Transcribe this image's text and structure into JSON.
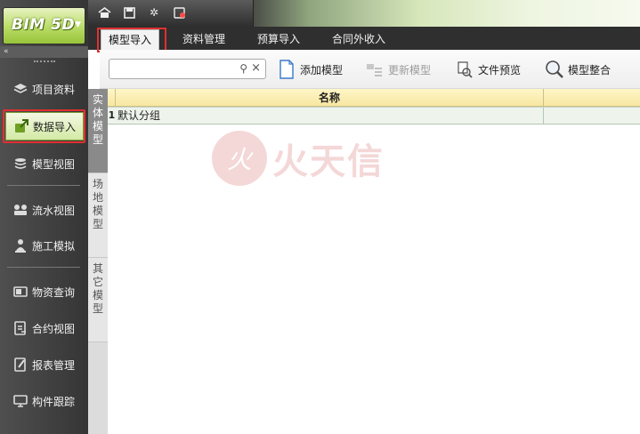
{
  "app": {
    "logo": "BIM 5D"
  },
  "sidebar": {
    "collapse_label": "«",
    "items": [
      {
        "label": "项目资料",
        "icon": "layers-icon"
      },
      {
        "label": "数据导入",
        "icon": "data-import-icon",
        "active": true
      },
      {
        "label": "模型视图",
        "icon": "model-view-icon"
      },
      {
        "label": "流水视图",
        "icon": "flow-view-icon"
      },
      {
        "label": "施工模拟",
        "icon": "construction-sim-icon"
      },
      {
        "label": "物资查询",
        "icon": "material-query-icon"
      },
      {
        "label": "合约视图",
        "icon": "contract-view-icon"
      },
      {
        "label": "报表管理",
        "icon": "report-icon"
      },
      {
        "label": "构件跟踪",
        "icon": "component-track-icon"
      }
    ]
  },
  "quick_access": [
    "home-icon",
    "save-icon",
    "settings-icon",
    "export-icon"
  ],
  "menu": {
    "tabs": [
      {
        "label": "模型导入",
        "active": true
      },
      {
        "label": "资料管理"
      },
      {
        "label": "预算导入"
      },
      {
        "label": "合同外收入"
      }
    ]
  },
  "toolbar": {
    "search_value": "",
    "add_model": "添加模型",
    "update_model": "更新模型",
    "file_preview": "文件预览",
    "model_merge": "模型整合"
  },
  "vertical_tabs": [
    {
      "label": "实体模型",
      "active": true
    },
    {
      "label": "场地模型"
    },
    {
      "label": "其它模型"
    }
  ],
  "grid": {
    "header": {
      "name": "名称"
    },
    "rows": [
      {
        "num": "1",
        "name": "默认分组"
      }
    ]
  },
  "watermark": {
    "text": "火天信"
  },
  "colors": {
    "accent_green": "#9dc83f",
    "highlight_red": "#e03030",
    "header_yellow": "#f7e7a0"
  }
}
